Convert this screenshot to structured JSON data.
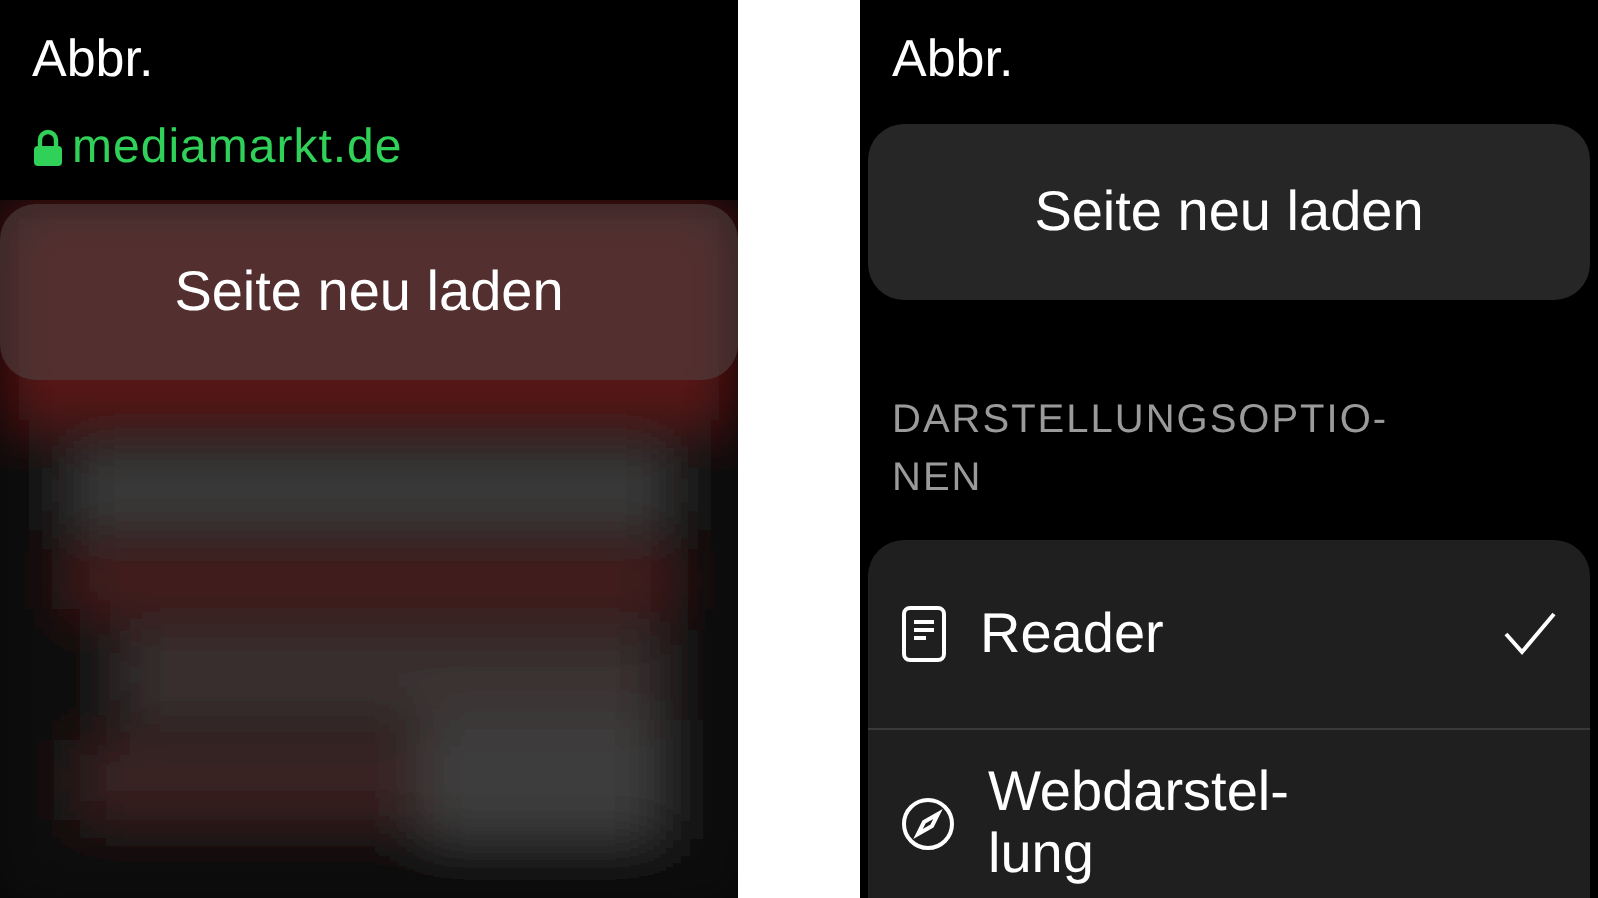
{
  "screens": [
    {
      "cancel": "Abbr.",
      "url": "mediamarkt.de",
      "secure": true,
      "reload_button": "Seite neu laden"
    },
    {
      "cancel": "Abbr.",
      "reload_button": "Seite neu laden",
      "section_heading": "DARSTELLUNGSOPTIO-\nNEN",
      "options": [
        {
          "kind": "reader",
          "label": "Reader",
          "selected": true
        },
        {
          "kind": "web",
          "label": "Webdarstel-\nlung",
          "selected": false
        }
      ]
    }
  ]
}
